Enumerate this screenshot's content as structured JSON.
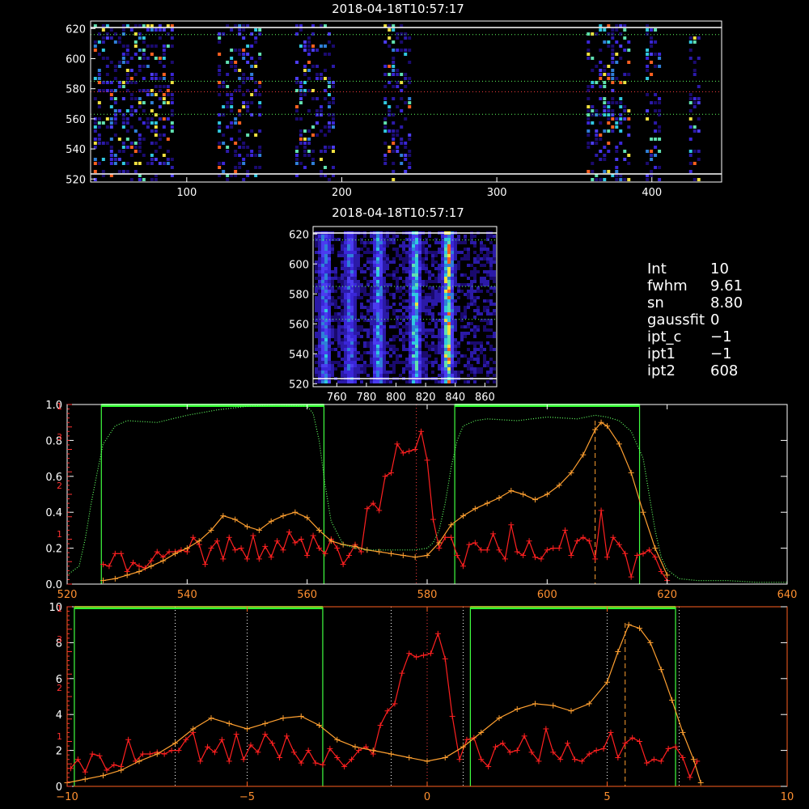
{
  "top_image": {
    "title": "2018-04-18T10:57:17",
    "x_ticks": [
      "100",
      "200",
      "300",
      "400"
    ],
    "y_ticks": [
      "520",
      "540",
      "560",
      "580",
      "600",
      "620"
    ],
    "xlim": [
      38,
      445
    ],
    "ylim": [
      518,
      625
    ],
    "strips": [
      [
        40,
        90
      ],
      [
        120,
        148
      ],
      [
        170,
        195
      ],
      [
        227,
        245
      ],
      [
        358,
        385
      ],
      [
        396,
        405
      ],
      [
        424,
        430
      ]
    ],
    "guide_lines_y": [
      616,
      585,
      563
    ],
    "center_line_y": 578
  },
  "mid_image": {
    "title": "2018-04-18T10:57:17",
    "x_ticks": [
      "760",
      "780",
      "800",
      "820",
      "840",
      "860"
    ],
    "y_ticks": [
      "520",
      "540",
      "560",
      "580",
      "600",
      "620"
    ],
    "xlim": [
      744,
      868
    ],
    "ylim": [
      518,
      625
    ],
    "bands": [
      [
        751,
        0.55
      ],
      [
        768,
        0.5
      ],
      [
        787,
        0.6
      ],
      [
        812,
        0.75
      ],
      [
        834,
        1.0
      ]
    ]
  },
  "info": [
    {
      "key": "Int",
      "value": "10"
    },
    {
      "key": "fwhm",
      "value": "9.61"
    },
    {
      "key": "sn",
      "value": "8.80"
    },
    {
      "key": "gaussfit",
      "value": "0"
    },
    {
      "key": "ipt_c",
      "value": "−1"
    },
    {
      "key": "ipt1",
      "value": "−1"
    },
    {
      "key": "ipt2",
      "value": "608"
    }
  ],
  "chart_data": [
    {
      "type": "line",
      "x_ticks": [
        "520",
        "540",
        "560",
        "580",
        "600",
        "620",
        "640"
      ],
      "y_ticks_left": [
        "0.0",
        "0.2",
        "0.4",
        "0.6",
        "0.8",
        "1.0"
      ],
      "y_ticks_red": [
        "1",
        "2",
        "3",
        "1"
      ],
      "xlim": [
        520,
        640
      ],
      "ylim": [
        0,
        1.0
      ],
      "filter_windows": [
        [
          525.7,
          562.8
        ],
        [
          584.6,
          615.4
        ]
      ],
      "vlines": [
        578.2,
        608.0
      ],
      "series": [
        {
          "color": "#ff2020",
          "x": [
            526,
            527,
            528,
            529,
            530,
            531,
            532,
            533,
            534,
            535,
            536,
            537,
            538,
            539,
            540,
            541,
            542,
            543,
            544,
            545,
            546,
            547,
            548,
            549,
            550,
            551,
            552,
            553,
            554,
            555,
            556,
            557,
            558,
            559,
            560,
            561,
            562,
            563,
            564,
            565,
            566,
            567,
            568,
            569,
            570,
            571,
            572,
            573,
            574,
            575,
            576,
            577,
            578,
            579,
            580,
            581,
            582,
            583,
            584,
            585,
            586,
            587,
            588,
            589,
            590,
            591,
            592,
            593,
            594,
            595,
            596,
            597,
            598,
            599,
            600,
            601,
            602,
            603,
            604,
            605,
            606,
            607,
            608,
            609,
            610,
            611,
            612,
            613,
            614,
            615,
            616,
            617,
            618,
            619,
            620
          ],
          "y": [
            0.11,
            0.1,
            0.17,
            0.17,
            0.07,
            0.12,
            0.1,
            0.09,
            0.13,
            0.18,
            0.15,
            0.18,
            0.18,
            0.19,
            0.18,
            0.26,
            0.22,
            0.11,
            0.2,
            0.24,
            0.14,
            0.26,
            0.19,
            0.2,
            0.14,
            0.27,
            0.14,
            0.21,
            0.15,
            0.24,
            0.19,
            0.29,
            0.23,
            0.25,
            0.16,
            0.27,
            0.2,
            0.17,
            0.25,
            0.2,
            0.11,
            0.16,
            0.22,
            0.18,
            0.42,
            0.45,
            0.41,
            0.6,
            0.62,
            0.78,
            0.73,
            0.74,
            0.75,
            0.85,
            0.69,
            0.36,
            0.2,
            0.26,
            0.26,
            0.16,
            0.1,
            0.22,
            0.23,
            0.19,
            0.19,
            0.28,
            0.19,
            0.14,
            0.33,
            0.18,
            0.16,
            0.24,
            0.15,
            0.14,
            0.19,
            0.2,
            0.2,
            0.3,
            0.16,
            0.24,
            0.26,
            0.24,
            0.14,
            0.41,
            0.15,
            0.26,
            0.22,
            0.17,
            0.04,
            0.16,
            0.17,
            0.19,
            0.15,
            0.07,
            0.02
          ]
        },
        {
          "color": "#ffa030",
          "x": [
            526,
            528,
            530,
            532,
            534,
            536,
            538,
            540,
            542,
            544,
            546,
            548,
            550,
            552,
            554,
            556,
            558,
            560,
            562,
            564,
            566,
            568,
            570,
            572,
            574,
            576,
            578,
            580,
            582,
            584,
            586,
            588,
            590,
            592,
            594,
            596,
            598,
            600,
            602,
            604,
            606,
            608,
            609,
            610,
            612,
            614,
            616,
            618,
            620
          ],
          "y": [
            0.02,
            0.03,
            0.05,
            0.07,
            0.1,
            0.13,
            0.17,
            0.2,
            0.24,
            0.3,
            0.38,
            0.36,
            0.32,
            0.3,
            0.35,
            0.38,
            0.4,
            0.37,
            0.3,
            0.24,
            0.22,
            0.21,
            0.19,
            0.18,
            0.17,
            0.16,
            0.15,
            0.16,
            0.23,
            0.33,
            0.38,
            0.42,
            0.45,
            0.48,
            0.52,
            0.5,
            0.47,
            0.5,
            0.55,
            0.62,
            0.72,
            0.86,
            0.9,
            0.88,
            0.78,
            0.62,
            0.4,
            0.2,
            0.05
          ]
        },
        {
          "color": "#60ff60",
          "dotted": true,
          "x": [
            520,
            522,
            523,
            524,
            525,
            526,
            528,
            530,
            535,
            540,
            545,
            550,
            555,
            560,
            561,
            562,
            563,
            564,
            566,
            568,
            570,
            575,
            578,
            580,
            581,
            582,
            583,
            584,
            585,
            586,
            588,
            590,
            595,
            600,
            605,
            608,
            610,
            612,
            614,
            616,
            617,
            618,
            619,
            620,
            622,
            625,
            630,
            635,
            640
          ],
          "y": [
            0.05,
            0.1,
            0.25,
            0.45,
            0.62,
            0.78,
            0.88,
            0.91,
            0.9,
            0.94,
            0.97,
            0.99,
            1.0,
            0.99,
            0.95,
            0.8,
            0.55,
            0.35,
            0.22,
            0.2,
            0.19,
            0.19,
            0.19,
            0.2,
            0.23,
            0.3,
            0.45,
            0.65,
            0.8,
            0.88,
            0.91,
            0.92,
            0.91,
            0.93,
            0.92,
            0.94,
            0.93,
            0.91,
            0.85,
            0.7,
            0.5,
            0.3,
            0.15,
            0.08,
            0.03,
            0.02,
            0.02,
            0.01,
            0.01
          ]
        }
      ]
    },
    {
      "type": "line",
      "x_ticks": [
        "−10",
        "−5",
        "0",
        "5",
        "10"
      ],
      "y_ticks_left": [
        "0",
        "2",
        "4",
        "6",
        "8",
        "10"
      ],
      "y_ticks_red": [
        "1",
        "2",
        "3",
        "1"
      ],
      "xlim": [
        -10,
        10
      ],
      "ylim": [
        0,
        10
      ],
      "filter_windows": [
        [
          -9.8,
          -2.9
        ],
        [
          1.2,
          6.9
        ]
      ],
      "vlines": [
        0,
        5.5
      ],
      "dotted_vlines": [
        -7,
        -5,
        -1,
        1,
        5,
        7
      ],
      "series": [
        {
          "color": "#ff2020",
          "x": [
            -9.9,
            -9.7,
            -9.5,
            -9.3,
            -9.1,
            -8.9,
            -8.7,
            -8.5,
            -8.3,
            -8.1,
            -7.9,
            -7.7,
            -7.5,
            -7.3,
            -7.1,
            -6.9,
            -6.7,
            -6.5,
            -6.3,
            -6.1,
            -5.9,
            -5.7,
            -5.5,
            -5.3,
            -5.1,
            -4.9,
            -4.7,
            -4.5,
            -4.3,
            -4.1,
            -3.9,
            -3.7,
            -3.5,
            -3.3,
            -3.1,
            -2.9,
            -2.7,
            -2.5,
            -2.3,
            -2.1,
            -1.9,
            -1.7,
            -1.5,
            -1.3,
            -1.1,
            -0.9,
            -0.7,
            -0.5,
            -0.3,
            -0.1,
            0.1,
            0.3,
            0.5,
            0.7,
            0.9,
            1.1,
            1.3,
            1.5,
            1.7,
            1.9,
            2.1,
            2.3,
            2.5,
            2.7,
            2.9,
            3.1,
            3.3,
            3.5,
            3.7,
            3.9,
            4.1,
            4.3,
            4.5,
            4.7,
            4.9,
            5.1,
            5.3,
            5.5,
            5.7,
            5.9,
            6.1,
            6.3,
            6.5,
            6.7,
            6.9,
            7.1,
            7.3,
            7.5
          ],
          "y": [
            1.0,
            1.5,
            0.8,
            1.8,
            1.7,
            0.9,
            1.2,
            1.1,
            2.6,
            1.4,
            1.8,
            1.8,
            1.9,
            1.8,
            2.0,
            2.0,
            2.6,
            3.0,
            1.4,
            2.2,
            1.9,
            2.6,
            1.4,
            2.9,
            1.5,
            2.3,
            1.9,
            2.9,
            2.4,
            1.6,
            2.8,
            1.9,
            1.3,
            2.0,
            1.3,
            1.2,
            2.1,
            1.6,
            1.1,
            1.5,
            2.0,
            2.2,
            1.8,
            3.4,
            4.2,
            4.6,
            6.3,
            7.4,
            7.2,
            7.3,
            7.4,
            8.5,
            7.1,
            3.9,
            1.5,
            2.6,
            2.7,
            1.5,
            1.1,
            2.2,
            2.4,
            1.9,
            2.0,
            2.8,
            1.9,
            1.4,
            3.2,
            1.9,
            1.5,
            2.4,
            1.5,
            1.4,
            1.8,
            2.0,
            2.1,
            3.0,
            1.6,
            2.4,
            2.7,
            2.5,
            1.3,
            1.5,
            1.4,
            2.1,
            2.2,
            1.6,
            0.5,
            1.4
          ]
        },
        {
          "color": "#ffa030",
          "x": [
            -10,
            -9.5,
            -9,
            -8.5,
            -8,
            -7.5,
            -7,
            -6.5,
            -6,
            -5.5,
            -5,
            -4.5,
            -4,
            -3.5,
            -3,
            -2.5,
            -2,
            -1.5,
            -1,
            -0.5,
            0,
            0.5,
            1,
            1.5,
            2,
            2.5,
            3,
            3.5,
            4,
            4.5,
            5,
            5.3,
            5.6,
            5.9,
            6.2,
            6.5,
            6.8,
            7.1,
            7.4,
            7.6
          ],
          "y": [
            0.2,
            0.4,
            0.6,
            0.9,
            1.4,
            1.8,
            2.4,
            3.2,
            3.8,
            3.5,
            3.2,
            3.5,
            3.8,
            3.9,
            3.4,
            2.6,
            2.2,
            2.0,
            1.8,
            1.6,
            1.4,
            1.6,
            2.2,
            3.0,
            3.8,
            4.3,
            4.6,
            4.5,
            4.2,
            4.6,
            5.8,
            7.5,
            9.0,
            8.8,
            8.0,
            6.5,
            4.8,
            3.0,
            1.5,
            0.2
          ]
        }
      ]
    }
  ]
}
